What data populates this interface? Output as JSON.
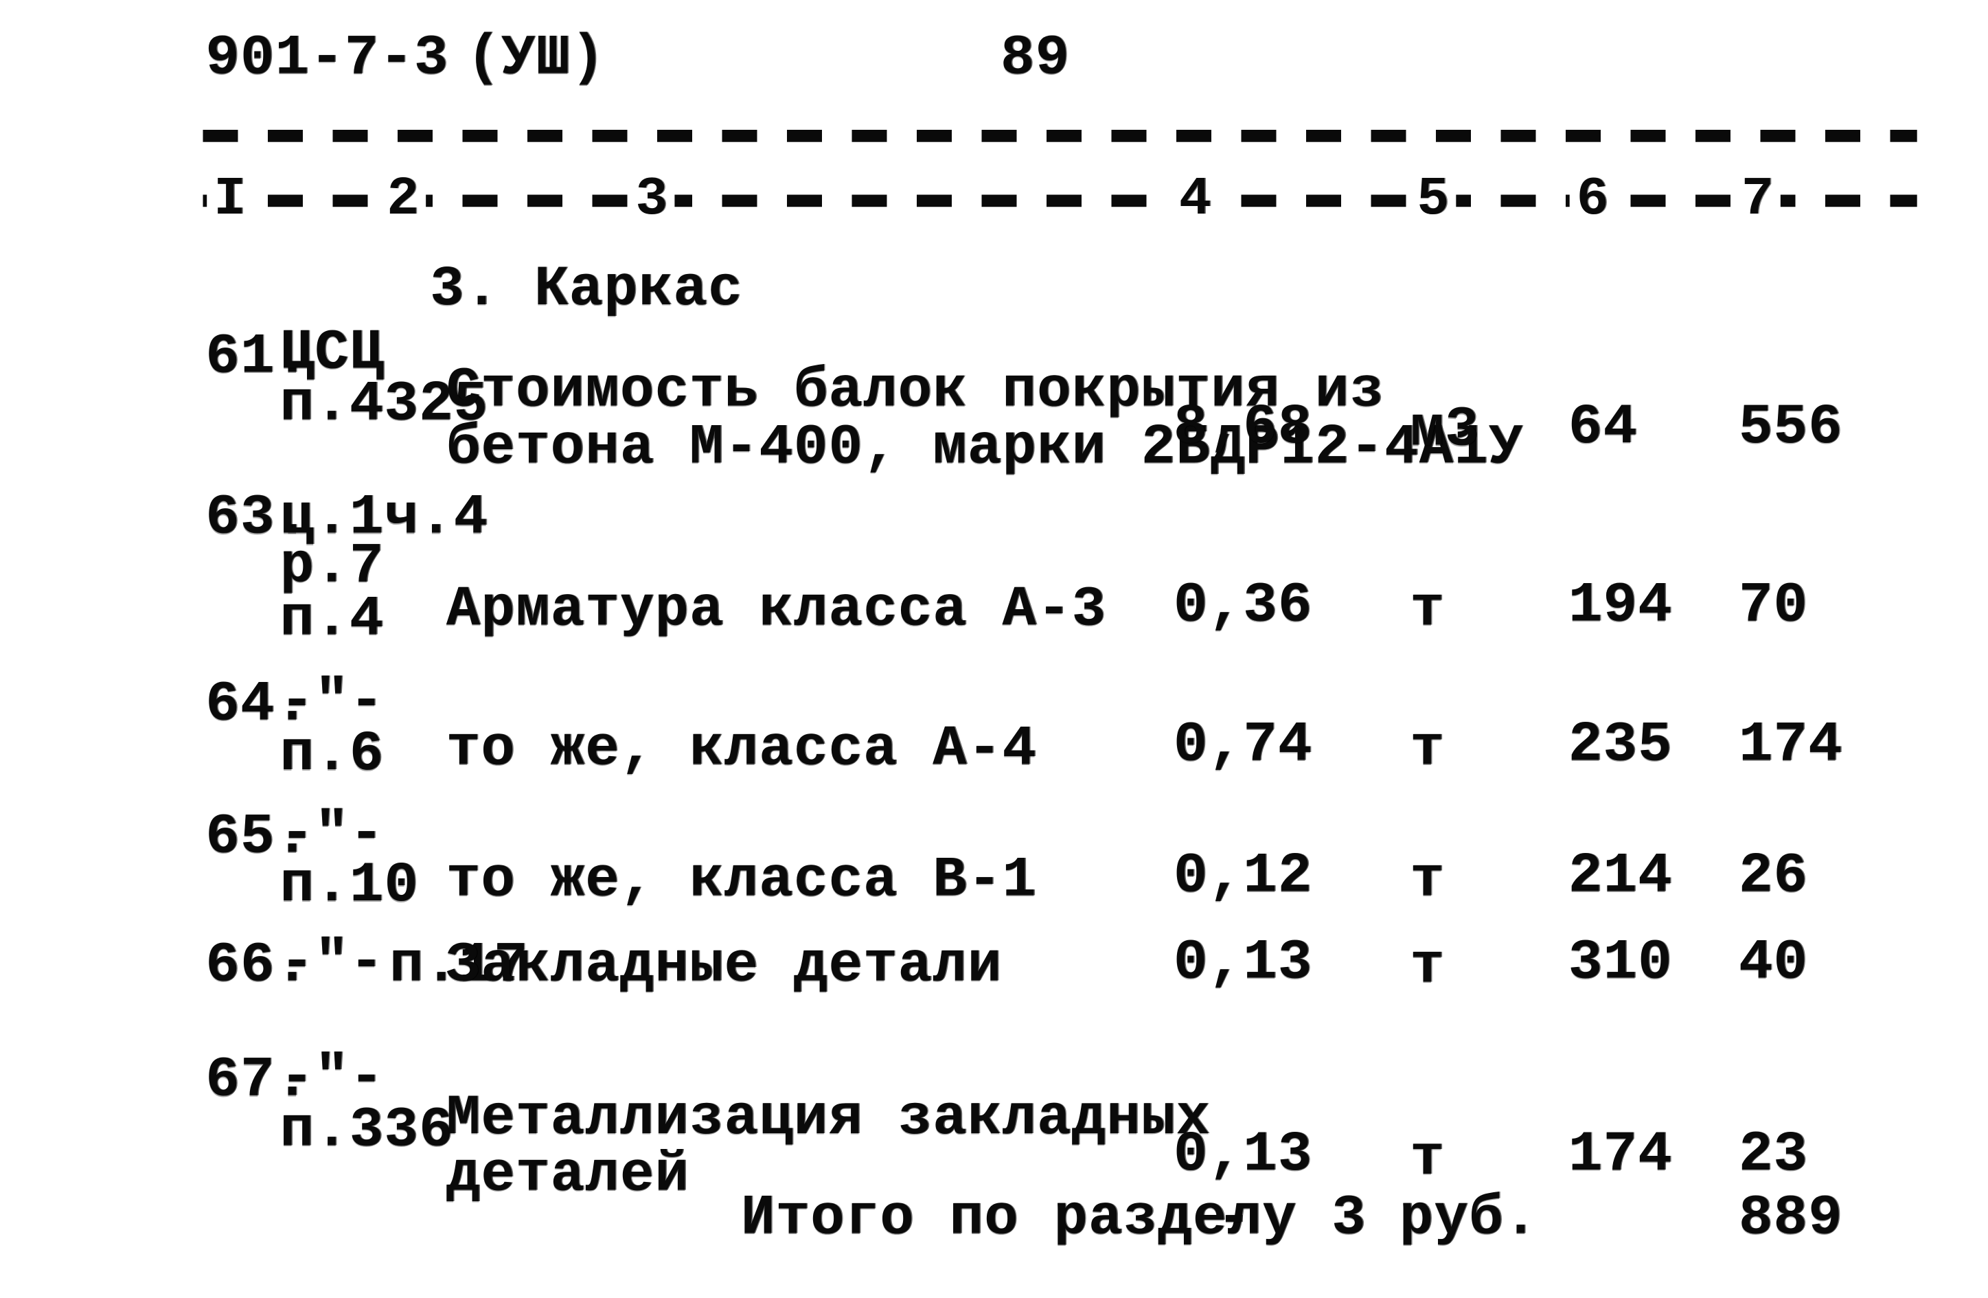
{
  "header": {
    "doc_code": "901-7-3",
    "doc_part": "(УШ)",
    "page_number": "89"
  },
  "table": {
    "column_numbers": [
      "I",
      "2",
      "3",
      "4",
      "5",
      "6",
      "7"
    ],
    "section_title": "3. Каркас",
    "rows": [
      {
        "num": "61.",
        "ref_lines": [
          "ЦСЦ",
          "п.4325"
        ],
        "desc_lines": [
          "Стоимость балок покрытия из",
          "бетона М-400, марки 2БДР12-4А1У"
        ],
        "qty": "8,68",
        "unit": "м3",
        "price": "64",
        "sum": "556"
      },
      {
        "num": "63.",
        "ref_lines": [
          "ц.1ч.4",
          "р.7",
          "п.4"
        ],
        "desc_lines": [
          "Арматура класса А-3"
        ],
        "qty": "0,36",
        "unit": "т",
        "price": "194",
        "sum": "70"
      },
      {
        "num": "64.",
        "ref_lines": [
          "-\"-",
          "п.6"
        ],
        "desc_lines": [
          "то же, класса А-4"
        ],
        "qty": "0,74",
        "unit": "т",
        "price": "235",
        "sum": "174"
      },
      {
        "num": "65.",
        "ref_lines": [
          "-\"-",
          "п.10"
        ],
        "desc_lines": [
          "то же, класса В-1"
        ],
        "qty": "0,12",
        "unit": "т",
        "price": "214",
        "sum": "26"
      },
      {
        "num": "66.",
        "ref_lines": [
          "-\"-",
          "п.17"
        ],
        "desc_lines": [
          "Закладные детали"
        ],
        "qty": "0,13",
        "unit": "т",
        "price": "310",
        "sum": "40"
      },
      {
        "num": "67.",
        "ref_lines": [
          "-\"-",
          "п.336"
        ],
        "desc_lines": [
          "Металлизация закладных",
          "деталей"
        ],
        "qty": "0,13",
        "unit": "т",
        "price": "174",
        "sum": "23"
      }
    ],
    "total": {
      "label": "Итого по разделу 3",
      "qty": "-",
      "unit": "руб.",
      "sum": "889"
    }
  }
}
